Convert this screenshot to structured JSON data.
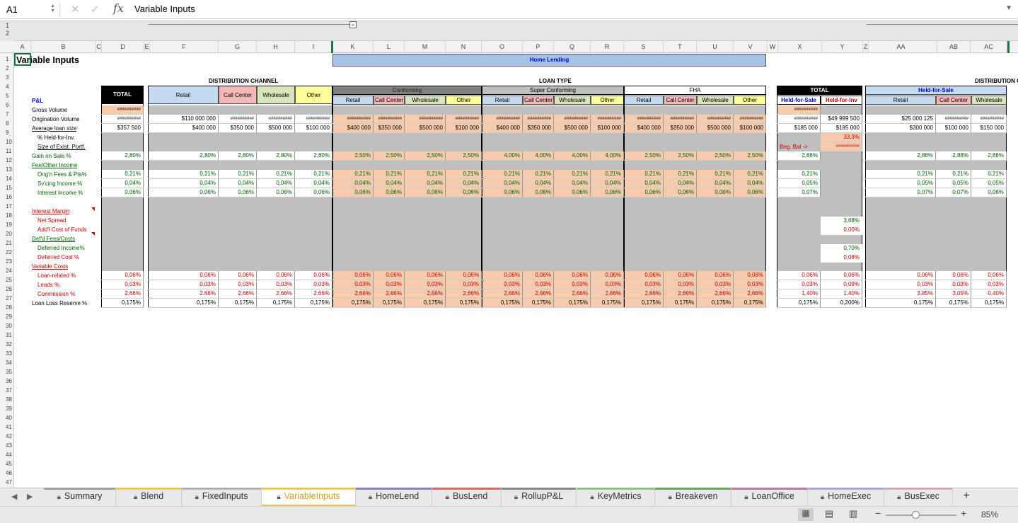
{
  "namebox": "A1",
  "formula": "Variable Inputs",
  "title": "Variable Inputs",
  "columns": [
    "A",
    "B",
    "C",
    "D",
    "E",
    "F",
    "G",
    "H",
    "I",
    "K",
    "L",
    "M",
    "N",
    "O",
    "P",
    "Q",
    "R",
    "S",
    "T",
    "U",
    "V",
    "W",
    "X",
    "Y",
    "Z",
    "AA",
    "AB",
    "AC"
  ],
  "rows": [
    "1",
    "2",
    "3",
    "4",
    "5",
    "6",
    "7",
    "8",
    "9",
    "10",
    "11",
    "12",
    "13",
    "14",
    "15",
    "16",
    "17",
    "18",
    "19",
    "20",
    "21",
    "22",
    "23",
    "24",
    "25",
    "26",
    "27",
    "28",
    "29",
    "30",
    "31",
    "32",
    "33",
    "34",
    "35",
    "36",
    "37",
    "38",
    "39",
    "40",
    "41",
    "42",
    "43",
    "44",
    "45",
    "46",
    "47"
  ],
  "outline_levels": [
    "1",
    "2"
  ],
  "headers": {
    "home_lending": "Home Lending",
    "distribution_channel": "DISTRIBUTION CHANNEL",
    "loan_type": "LOAN TYPE",
    "distribution_cut": "DISTRIBUTION C",
    "total": "TOTAL",
    "pl": "P&L",
    "conforming": "Conforming",
    "super_conforming": "Super Conforming",
    "fha": "FHA",
    "held_for_sale": "Held-for-Sale",
    "held_for_inv": "Held-for-Inv",
    "channels": [
      "Retail",
      "Call Center",
      "Wholesale",
      "Other"
    ]
  },
  "labels": {
    "gross_volume": "Gross Volume",
    "orig_volume": "Origination Volume",
    "avg_loan": "Average loan size",
    "held_for_inv_pct": "% Held-for-Inv.",
    "size_portf": "Size of Exist. Portf.",
    "gain_on_sale": "Gain on Sale %",
    "fee_other": "Fee/Other Income",
    "orig_fees": "Orig'n Fees & Pts%",
    "svc_income": "Sv'cing Income %",
    "interest_income": "Interest Income %",
    "interest_margin": "Interest Margin",
    "net_spread": "Net Spread",
    "addl_cost": "Add'l Cost of Funds",
    "defd_fees": "Def'd Fees/Costs",
    "deferred_income": "Deferred Income%",
    "deferred_cost": "Deferred Cost %",
    "variable_costs": "Variable Costs",
    "loan_related": "Loan-related %",
    "leads": "Leads %",
    "commission": "Commission %",
    "loan_loss": "Loan Loss Reserve %",
    "beg_bal": "Beg. Bal ->"
  },
  "values": {
    "hash": "##########",
    "total_avg": "$357 500",
    "retail_orig": "$110 000 000",
    "avg_sizes": [
      "$400 000",
      "$350 000",
      "$500 000",
      "$100 000"
    ],
    "gain_total": "2,80%",
    "gain_conf": "2,50%",
    "gain_super": "4,00%",
    "gain_fha": "2,50%",
    "orig_fee": "0,21%",
    "svc": "0,04%",
    "int": "0,06%",
    "loan_rel": "0,06%",
    "leads": "0,03%",
    "comm": "2,66%",
    "llr": "0,175%",
    "hfs_avg": "$185 000",
    "hfi_orig": "$49 999 500",
    "hfi_avg": "$185 000",
    "hfi_pct": "33,3%",
    "hfs_gain": "2,88%",
    "hfs_svc": "0,05%",
    "hfs_int": "0,07%",
    "hfi_net_spread": "3,68%",
    "hfi_addl": "0,00%",
    "hfi_def_inc": "0,70%",
    "hfi_def_cost": "0,08%",
    "hfs_leads": "0,03%",
    "hfi_leads": "0,09%",
    "hfs_comm": "1,40%",
    "hfi_comm": "1,40%",
    "hfs_llr": "0,175%",
    "hfi_llr": "0,200%",
    "aa_orig": "$25 000 125",
    "aa_avg": [
      "$300 000",
      "$100 000",
      "$150 000"
    ],
    "aa_gain": "2,88%",
    "aa_svc": "0,05%",
    "aa_int": [
      "0,07%",
      "0,07%",
      "0,06%"
    ],
    "aa_comm": [
      "3,85%",
      "3,05%",
      "0,40%"
    ]
  },
  "tabs": [
    {
      "label": "Summary",
      "color": "#a0a0a0"
    },
    {
      "label": "Blend",
      "color": "#f2c94c"
    },
    {
      "label": "FixedInputs",
      "color": "#b0b0b0"
    },
    {
      "label": "VariableInputs",
      "color": "#f2c94c",
      "active": true
    },
    {
      "label": "HomeLend",
      "color": "#8e7cc3"
    },
    {
      "label": "BusLend",
      "color": "#e06666"
    },
    {
      "label": "RollupP&L",
      "color": "#888888"
    },
    {
      "label": "KeyMetrics",
      "color": "#93c47d"
    },
    {
      "label": "Breakeven",
      "color": "#6aa84f"
    },
    {
      "label": "LoanOffice",
      "color": "#c27ba0"
    },
    {
      "label": "HomeExec",
      "color": "#b4a7d6"
    },
    {
      "label": "BusExec",
      "color": "#d5a6bd"
    }
  ],
  "add_tab": "+",
  "zoom": "85%",
  "zoom_minus": "−",
  "zoom_plus": "+"
}
